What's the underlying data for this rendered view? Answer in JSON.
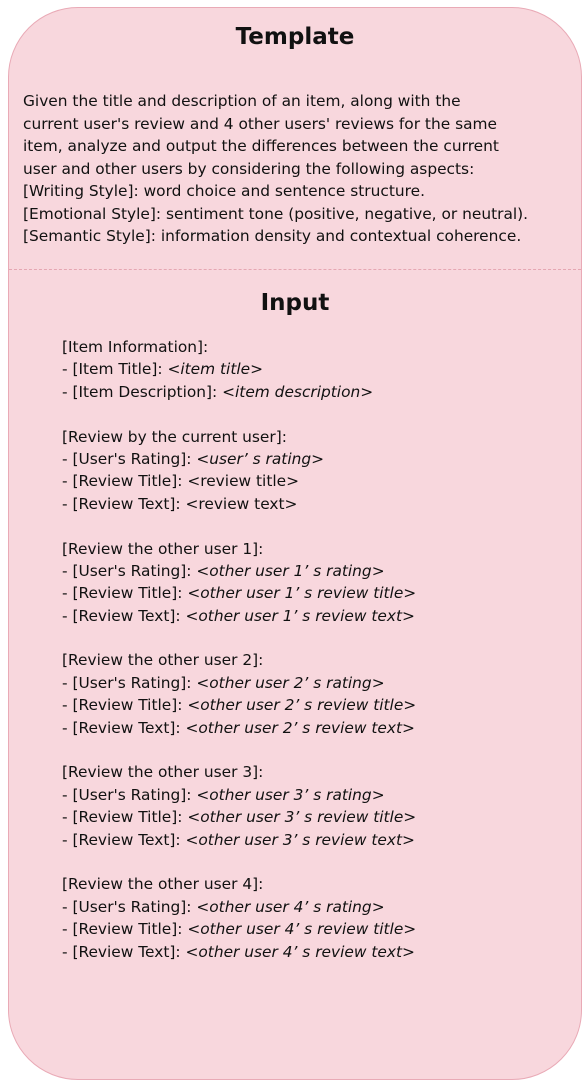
{
  "template": {
    "title": "Template",
    "lines": [
      "Given the title and description of an item, along with the",
      "current user's review and 4 other users' reviews for the same",
      "item, analyze and output the differences between the current",
      "user and other users by considering the following aspects:",
      "[Writing Style]: word choice and sentence structure.",
      "[Emotional Style]: sentiment tone (positive, negative, or neutral).",
      "[Semantic Style]: information density and contextual coherence."
    ]
  },
  "input": {
    "title": "Input",
    "item": {
      "header": "[Item Information]:",
      "title_label": "- [Item Title]: ",
      "title_ph": "<item title>",
      "desc_label": "- [Item Description]: ",
      "desc_ph": "<item description>"
    },
    "current": {
      "header": "[Review by the current user]:",
      "rating_label": "- [User's Rating]: ",
      "rating_ph": "<user’ s rating>",
      "rtitle_label": "- [Review Title]: ",
      "rtitle_ph": "<review title>",
      "rtext_label": "- [Review Text]: ",
      "rtext_ph": "<review text>"
    },
    "others": [
      {
        "header": "[Review the other user 1]:",
        "rating_label": "- [User's Rating]: ",
        "rating_ph": "<other user 1’ s rating>",
        "rtitle_label": "- [Review Title]: ",
        "rtitle_ph": "<other user 1’ s review title>",
        "rtext_label": "- [Review Text]: ",
        "rtext_ph": "<other user 1’ s  review text>"
      },
      {
        "header": "[Review the other user 2]:",
        "rating_label": "- [User's Rating]: ",
        "rating_ph": "<other user 2’ s rating>",
        "rtitle_label": "- [Review Title]: ",
        "rtitle_ph": "<other user 2’ s review title>",
        "rtext_label": "- [Review Text]: ",
        "rtext_ph": "<other user 2’ s  review text>"
      },
      {
        "header": "[Review the other user 3]:",
        "rating_label": "- [User's Rating]: ",
        "rating_ph": "<other user 3’ s rating>",
        "rtitle_label": "- [Review Title]: ",
        "rtitle_ph": "<other user 3’ s review title>",
        "rtext_label": "- [Review Text]: ",
        "rtext_ph": "<other user 3’ s  review text>"
      },
      {
        "header": "[Review the other user 4]:",
        "rating_label": "- [User's Rating]: ",
        "rating_ph": "<other user 4’ s rating>",
        "rtitle_label": "- [Review Title]: ",
        "rtitle_ph": "<other user 4’ s review title>",
        "rtext_label": "- [Review Text]: ",
        "rtext_ph": "<other user 4’ s  review text>"
      }
    ]
  }
}
